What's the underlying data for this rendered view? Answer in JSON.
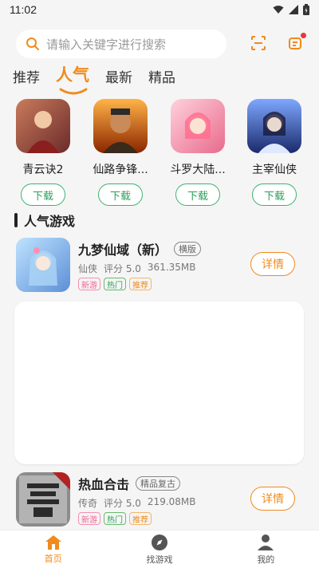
{
  "status": {
    "time": "11:02"
  },
  "search": {
    "placeholder": "请输入关键字进行搜索"
  },
  "tabs": [
    {
      "label": "推荐"
    },
    {
      "label": "人气"
    },
    {
      "label": "最新"
    },
    {
      "label": "精品"
    }
  ],
  "featured": [
    {
      "name": "青云诀2",
      "button": "下载"
    },
    {
      "name": "仙路争锋...",
      "button": "下载"
    },
    {
      "name": "斗罗大陆...",
      "button": "下载"
    },
    {
      "name": "主宰仙侠",
      "button": "下载"
    }
  ],
  "section": {
    "title": "人气游戏"
  },
  "games": [
    {
      "name": "九梦仙域（新）",
      "tag": "横版",
      "category": "仙侠",
      "rating": "评分 5.0",
      "size": "361.35MB",
      "labels": [
        "新游",
        "热门",
        "推荐"
      ],
      "button": "详情"
    },
    {
      "name": "热血合击",
      "tag": "精品复古",
      "category": "传奇",
      "rating": "评分 5.0",
      "size": "219.08MB",
      "labels": [
        "新游",
        "热门",
        "推荐"
      ],
      "button": "详情"
    }
  ],
  "nav": [
    {
      "label": "首页"
    },
    {
      "label": "找游戏"
    },
    {
      "label": "我的"
    }
  ],
  "colors": {
    "accent": "#f08b1c",
    "green": "#3cb371",
    "background": "#f5f5f5"
  }
}
